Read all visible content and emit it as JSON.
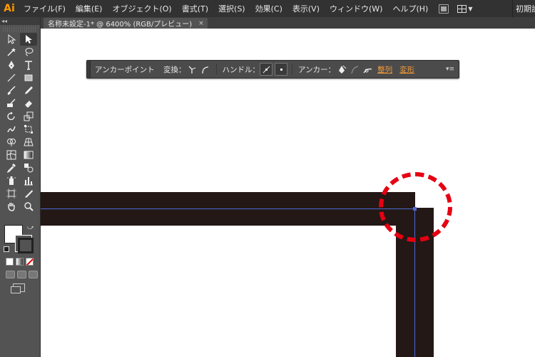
{
  "app": {
    "logo": "Ai"
  },
  "menu": {
    "items": [
      "ファイル(F)",
      "編集(E)",
      "オブジェクト(O)",
      "書式(T)",
      "選択(S)",
      "効果(C)",
      "表示(V)",
      "ウィンドウ(W)",
      "ヘルプ(H)"
    ],
    "workspace": "初期設"
  },
  "document": {
    "tab_title": "名称未設定-1* @ 6400% (RGB/プレビュー)",
    "close": "×"
  },
  "tools_panel": {
    "collapse": "◂◂"
  },
  "control_bar": {
    "anchor_point_label": "アンカーポイント",
    "convert_label": "変換：",
    "handle_label": "ハンドル：",
    "anchor_label": "アンカー：",
    "align_link": "整列",
    "transform_link": "変形",
    "menu": "▾≡"
  },
  "colors": {
    "artwork": "#231815",
    "path": "#4b6bd6",
    "highlight": "#e60012",
    "link": "#f29b3b"
  }
}
